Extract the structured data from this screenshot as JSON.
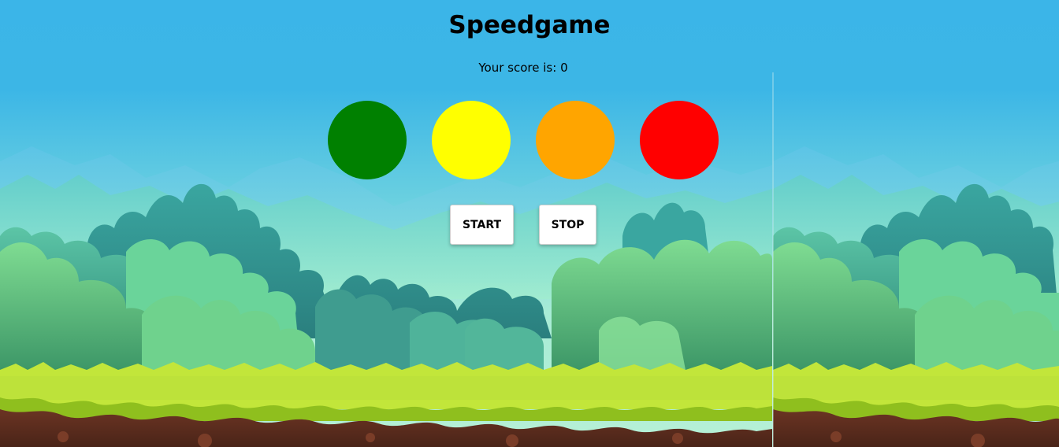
{
  "header": {
    "title": "Speedgame",
    "score_label": "Your score is:",
    "score_value": "0"
  },
  "circles": [
    {
      "name": "green",
      "color": "#008000"
    },
    {
      "name": "yellow",
      "color": "#FFFF00"
    },
    {
      "name": "orange",
      "color": "#FFA500"
    },
    {
      "name": "red",
      "color": "#FF0000"
    }
  ],
  "controls": {
    "start_label": "START",
    "stop_label": "STOP"
  },
  "background": {
    "sky_top": "#3bb4e8",
    "sky_bottom": "#a8ecd6",
    "grass": "#bfe63a",
    "soil": "#5b2e1f"
  }
}
